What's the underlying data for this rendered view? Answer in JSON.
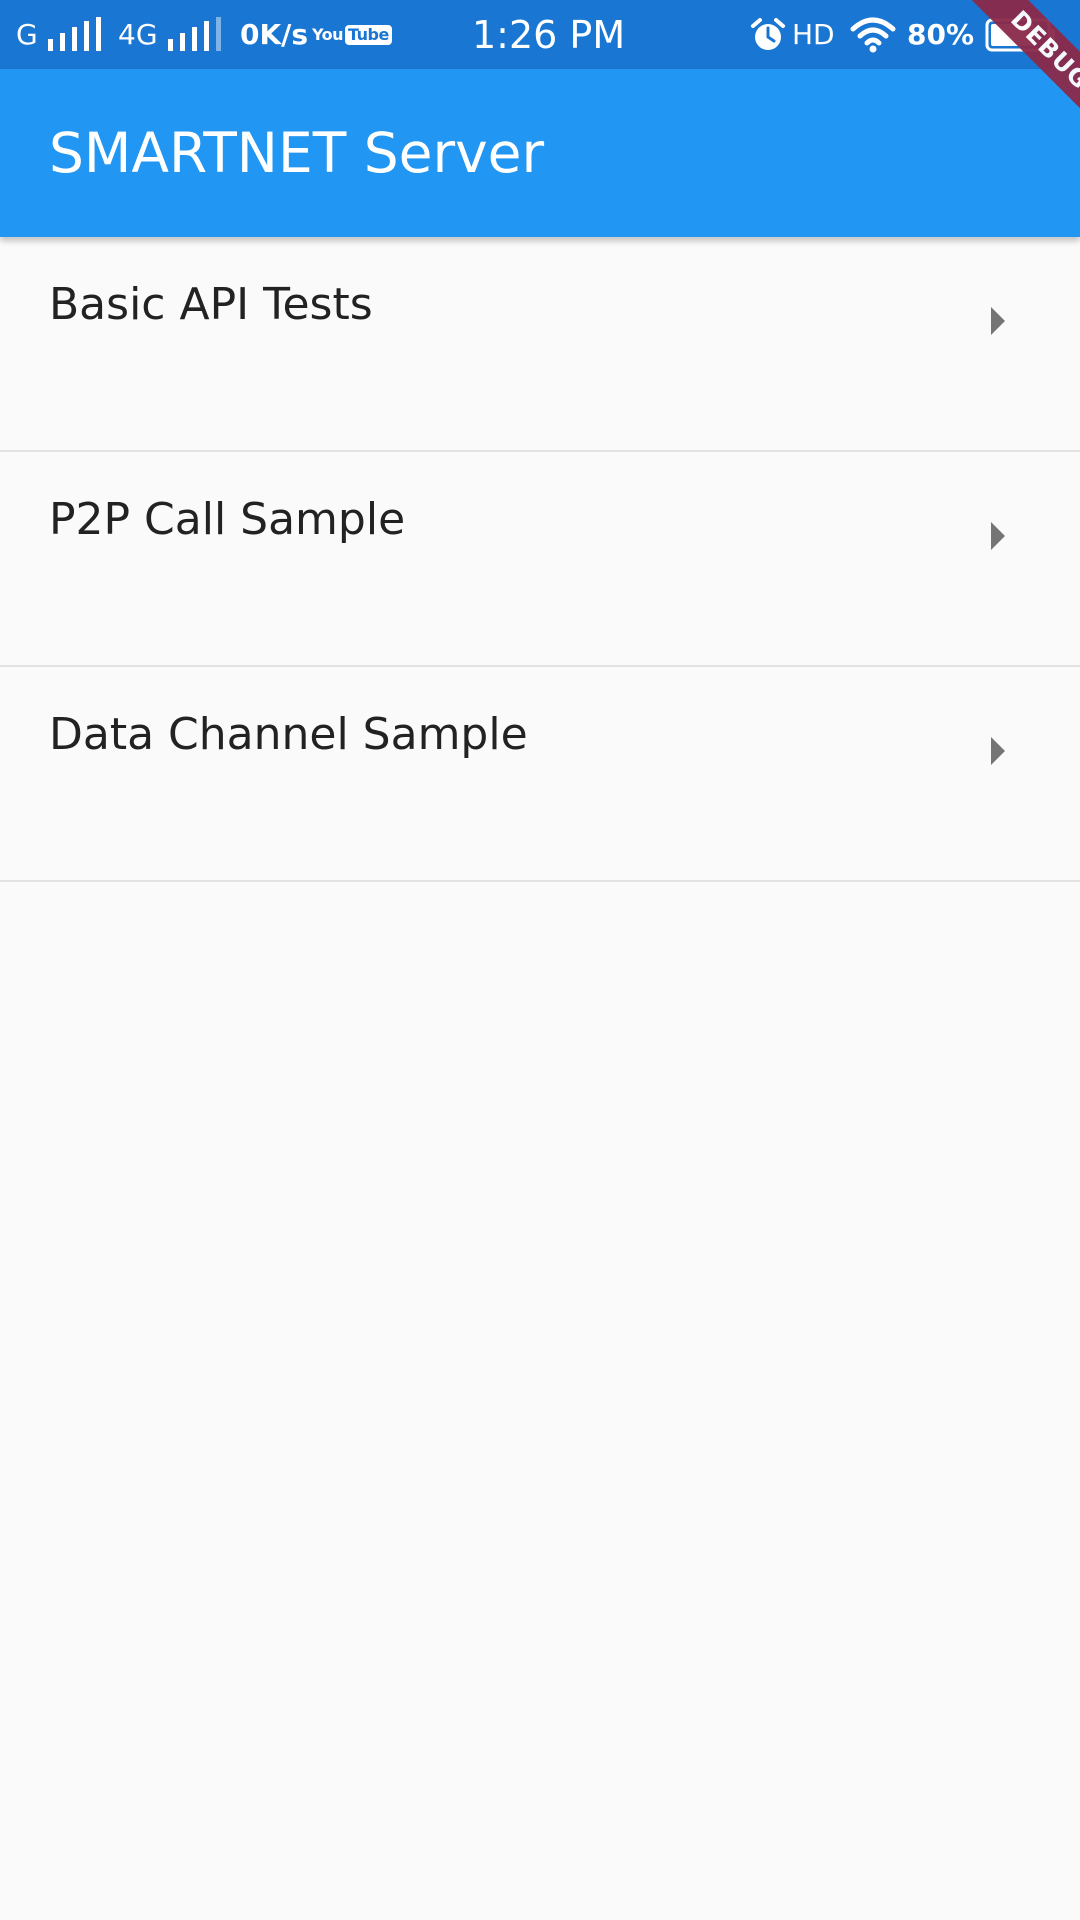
{
  "status_bar": {
    "network_1": "G",
    "network_2": "4G",
    "speed": "0K/s",
    "yt_you": "You",
    "yt_tube": "Tube",
    "time": "1:26 PM",
    "hd": "HD",
    "battery_percent": "80%",
    "battery_level": 0.8,
    "icons": [
      "signal-icon",
      "signal-icon",
      "youtube-icon",
      "alarm-icon",
      "wifi-icon",
      "battery-icon"
    ]
  },
  "app_bar": {
    "title": "SMARTNET Server"
  },
  "list": {
    "items": [
      {
        "label": "Basic API Tests",
        "icon": "chevron-right-icon"
      },
      {
        "label": "P2P Call Sample",
        "icon": "chevron-right-icon"
      },
      {
        "label": "Data Channel Sample",
        "icon": "chevron-right-icon"
      }
    ]
  },
  "debug_banner": {
    "label": "DEBUG"
  },
  "colors": {
    "status_bar": "#1976d2",
    "app_bar": "#2196f3",
    "background": "#fafafa",
    "divider": "#e2e2e2",
    "chevron": "#757575",
    "debug_banner": "#8b2a4a"
  }
}
